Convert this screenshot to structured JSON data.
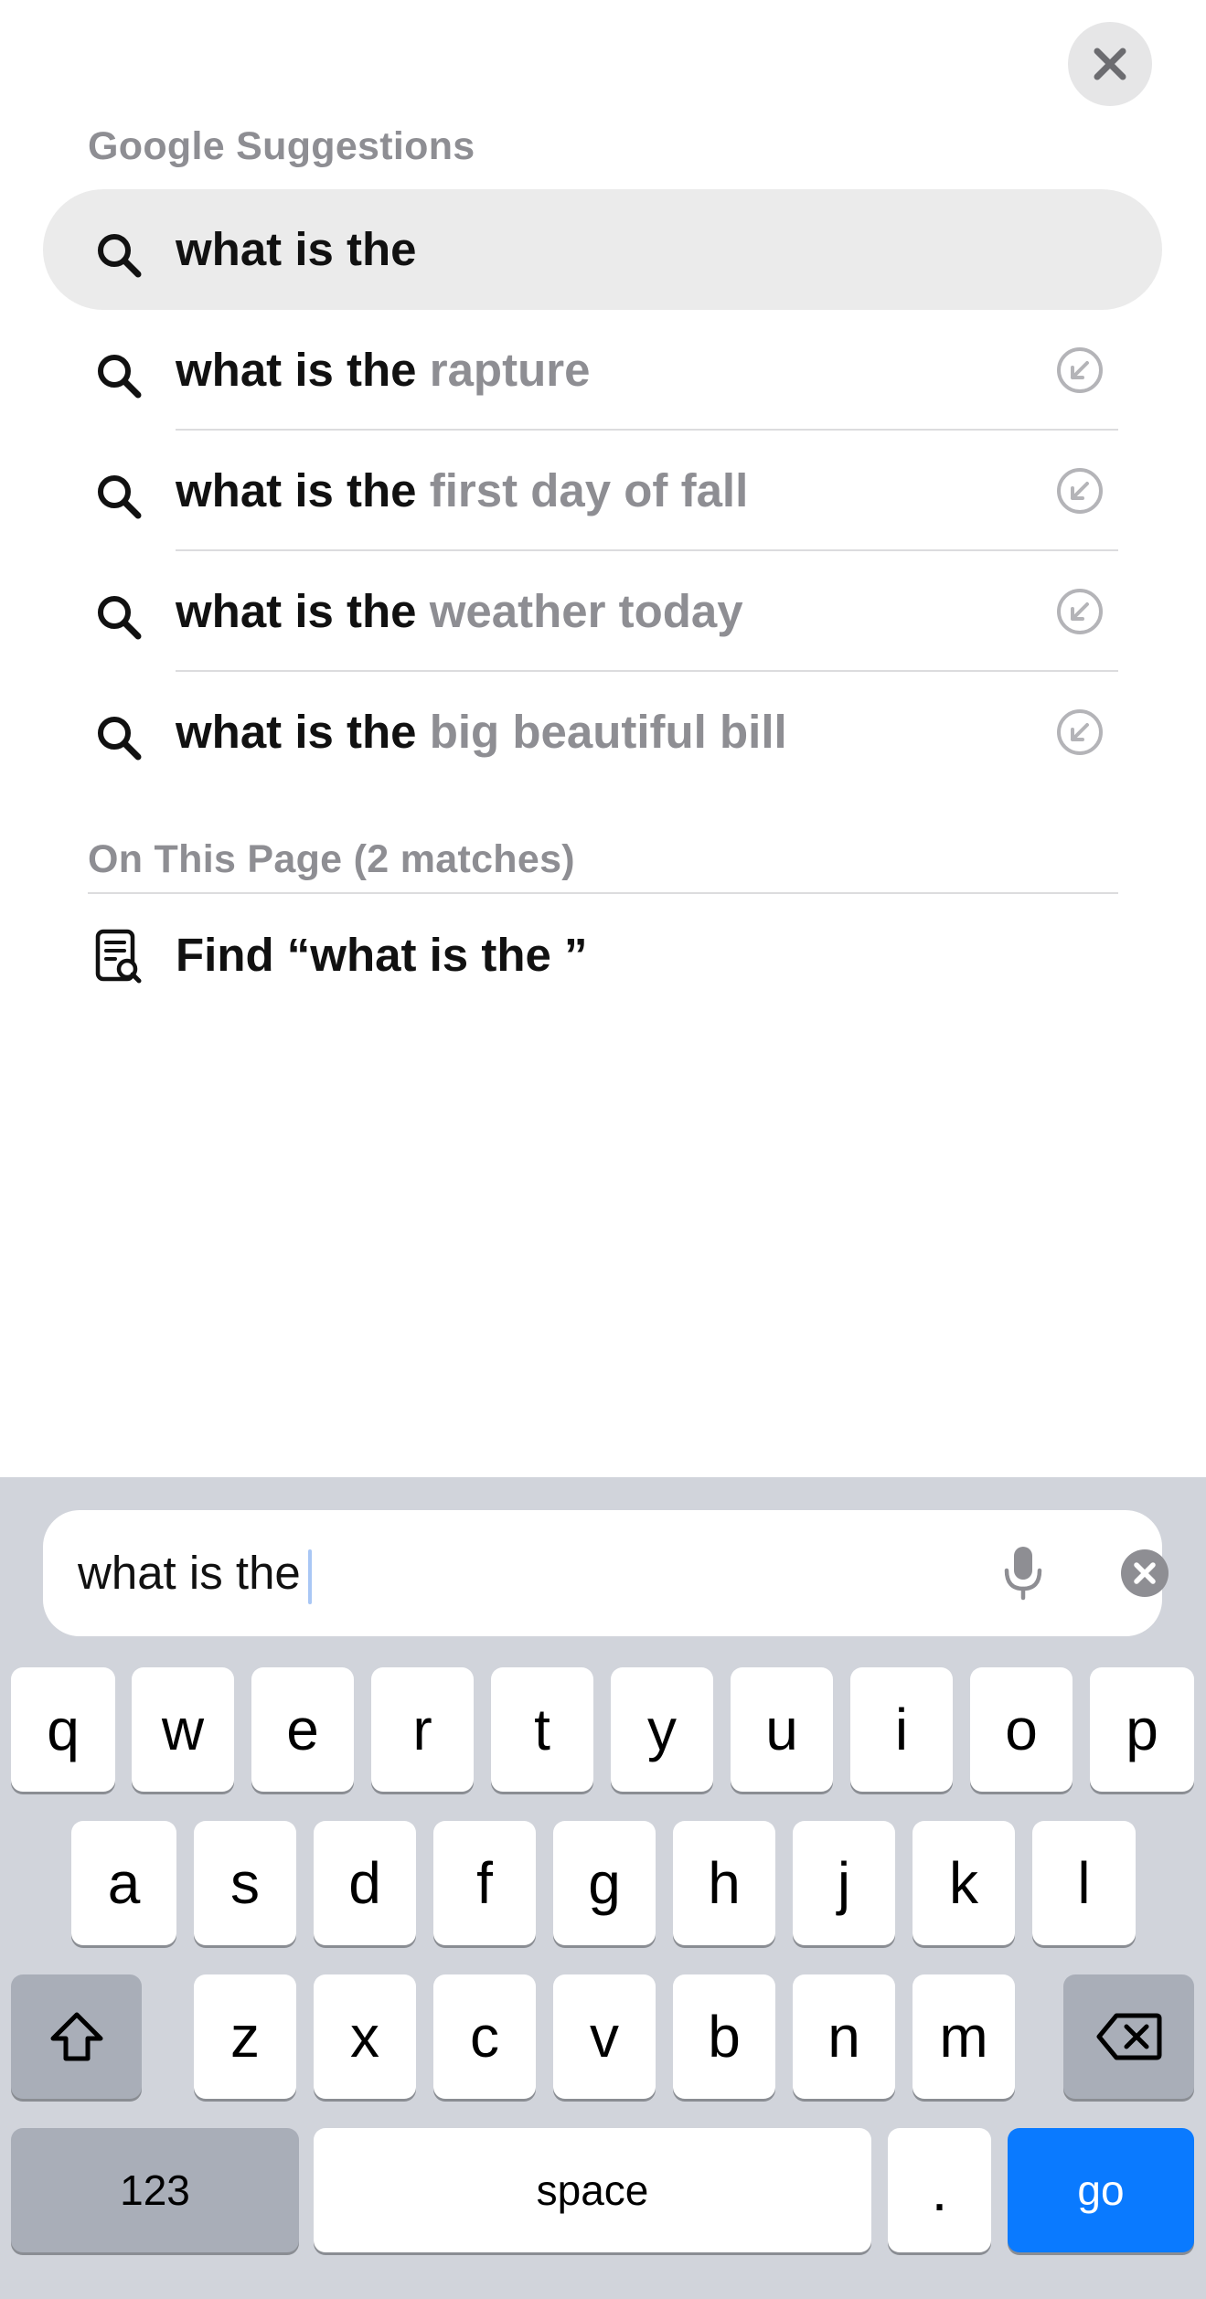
{
  "close_button": {
    "icon": "close-icon"
  },
  "google_suggestions": {
    "header": "Google Suggestions",
    "top_hit": {
      "typed": "what is the"
    },
    "items": [
      {
        "typed": "what is the",
        "completion": " rapture"
      },
      {
        "typed": "what is the",
        "completion": " first day of fall"
      },
      {
        "typed": "what is the",
        "completion": " weather today"
      },
      {
        "typed": "what is the",
        "completion": " big beautiful bill"
      }
    ]
  },
  "on_this_page": {
    "header": "On This Page (2 matches)",
    "find_label": "Find “what is the ”"
  },
  "address_bar": {
    "value": "what is the",
    "mic_icon": "microphone-icon",
    "clear_icon": "clear-text-icon"
  },
  "keyboard": {
    "row1": [
      "q",
      "w",
      "e",
      "r",
      "t",
      "y",
      "u",
      "i",
      "o",
      "p"
    ],
    "row2": [
      "a",
      "s",
      "d",
      "f",
      "g",
      "h",
      "j",
      "k",
      "l"
    ],
    "row3": [
      "z",
      "x",
      "c",
      "v",
      "b",
      "n",
      "m"
    ],
    "numbers_label": "123",
    "space_label": "space",
    "period_label": ".",
    "go_label": "go",
    "shift_icon": "shift-icon",
    "delete_icon": "delete-icon",
    "accent_color": "#0a7aff"
  }
}
